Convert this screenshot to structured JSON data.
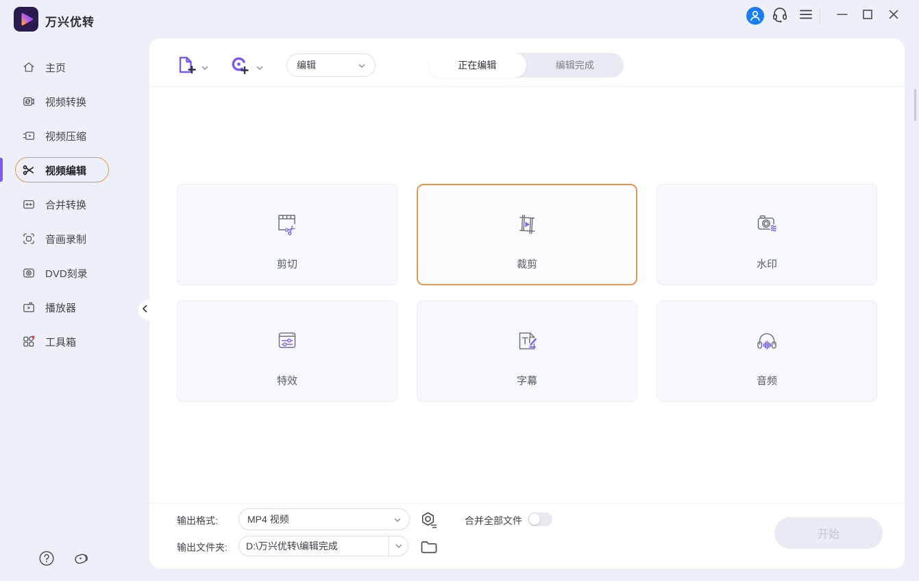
{
  "window": {
    "title": "万兴优转"
  },
  "header": {
    "icons": {
      "avatar": "user-avatar",
      "support": "headset",
      "menu": "hamburger-menu",
      "minimize": "minimize",
      "maximize": "maximize",
      "close": "close"
    }
  },
  "sidebar": {
    "items": [
      {
        "label": "主页",
        "icon": "home",
        "active": false
      },
      {
        "label": "视频转换",
        "icon": "video-convert",
        "active": false
      },
      {
        "label": "视频压缩",
        "icon": "video-compress",
        "active": false
      },
      {
        "label": "视频编辑",
        "icon": "scissors",
        "active": true
      },
      {
        "label": "合并转换",
        "icon": "merge-convert",
        "active": false
      },
      {
        "label": "音画录制",
        "icon": "screen-record",
        "active": false
      },
      {
        "label": "DVD刻录",
        "icon": "dvd-disc",
        "active": false
      },
      {
        "label": "播放器",
        "icon": "player-tv",
        "active": false
      },
      {
        "label": "工具箱",
        "icon": "toolbox-grid",
        "badge": true,
        "active": false
      }
    ]
  },
  "toolbar": {
    "add_file_icon": "document-plus",
    "add_source_icon": "disc-plus",
    "mode_select": {
      "value": "编辑"
    },
    "tabs": [
      {
        "label": "正在编辑",
        "active": true
      },
      {
        "label": "编辑完成",
        "active": false
      }
    ]
  },
  "cards": [
    {
      "label": "剪切",
      "icon": "film-scissors",
      "selected": false
    },
    {
      "label": "裁剪",
      "icon": "crop-play",
      "selected": true
    },
    {
      "label": "水印",
      "icon": "camera-waves",
      "selected": false
    },
    {
      "label": "特效",
      "icon": "window-sliders",
      "selected": false
    },
    {
      "label": "字幕",
      "icon": "document-pen",
      "selected": false
    },
    {
      "label": "音频",
      "icon": "headphones-wave",
      "selected": false
    }
  ],
  "footer": {
    "output_format_label": "输出格式:",
    "output_format_value": "MP4 视频",
    "output_folder_label": "输出文件夹:",
    "output_folder_value": "D:\\万兴优转\\编辑完成",
    "merge_all_label": "合并全部文件",
    "merge_all_on": false,
    "start_label": "开始",
    "start_enabled": false
  },
  "colors": {
    "accent_purple": "#7a57f0",
    "accent_orange": "#e2974f",
    "avatar_blue": "#187cf2",
    "badge_red": "#e24a3b",
    "background": "#edf0f8",
    "panel": "#ffffff"
  }
}
